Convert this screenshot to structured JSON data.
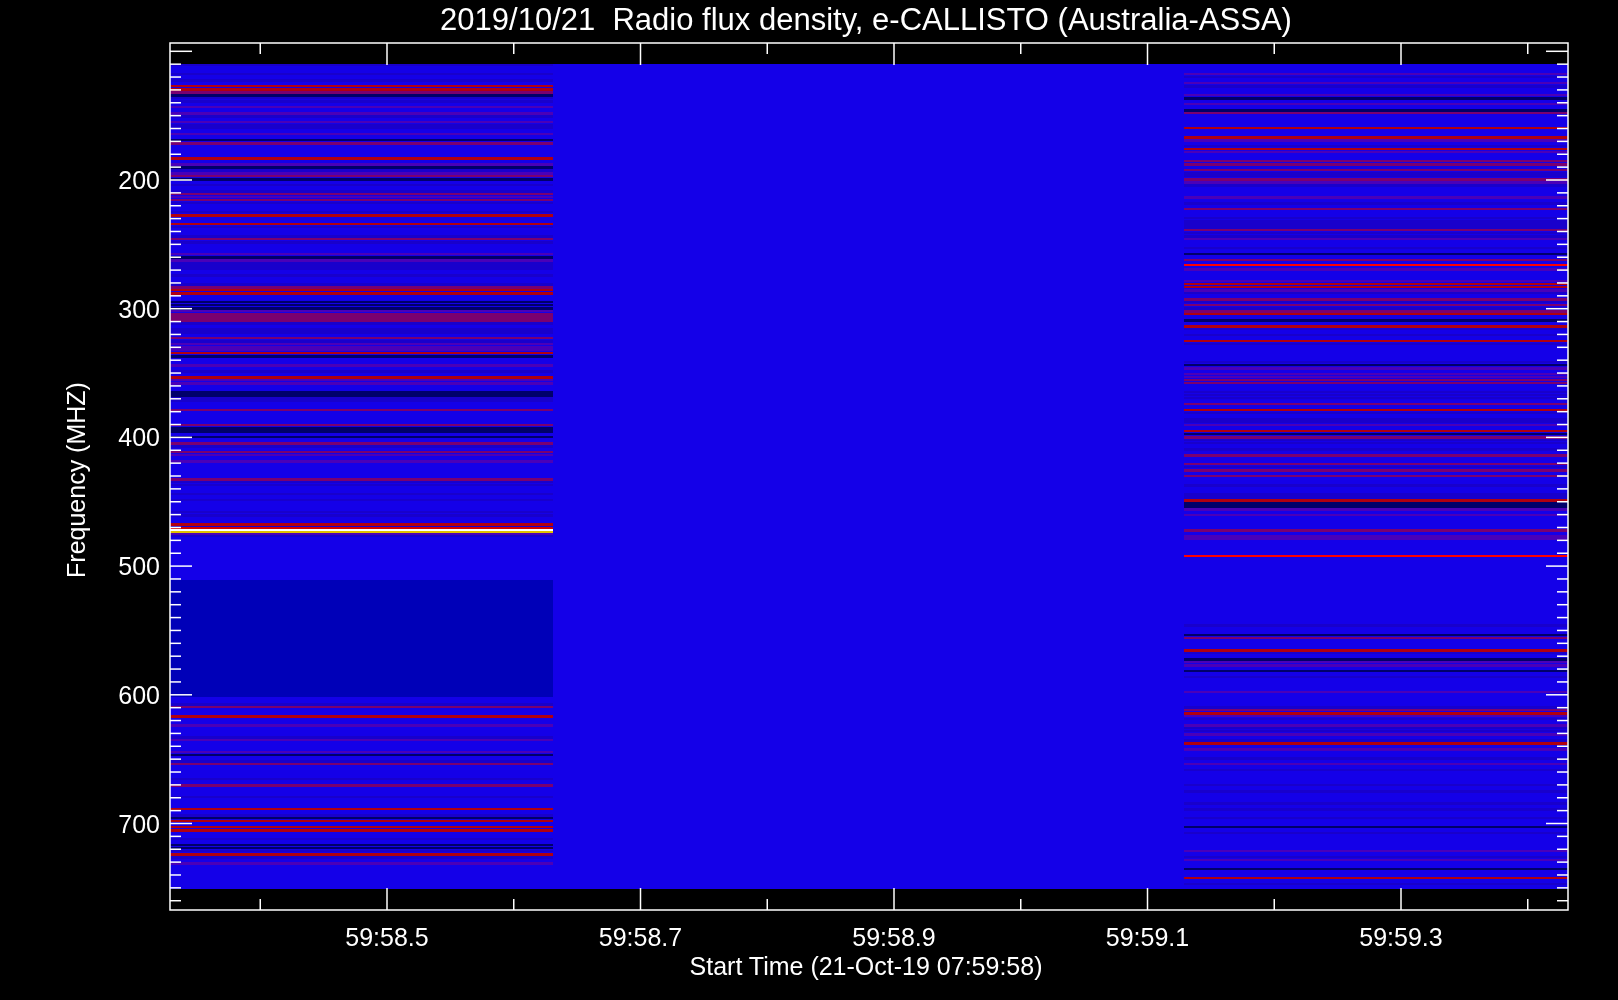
{
  "title": "2019/10/21  Radio flux density, e-CALLISTO (Australia-ASSA)",
  "plot": {
    "xlabel": "Start Time (21-Oct-19 07:59:58)",
    "ylabel": "Frequency (MHZ)",
    "xticks": [
      "59:58.5",
      "59:58.7",
      "59:58.9",
      "59:59.1",
      "59:59.3"
    ],
    "yticks": [
      "200",
      "300",
      "400",
      "500",
      "600",
      "700"
    ]
  }
}
